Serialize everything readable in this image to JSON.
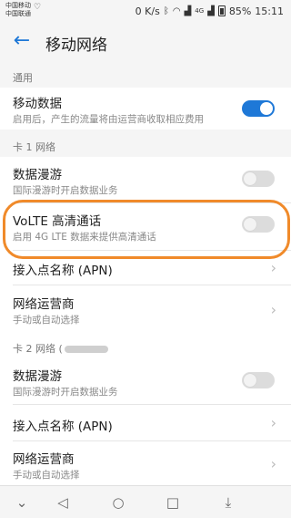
{
  "status_bar": {
    "carrier1": "中国移动",
    "carrier2": "中国联通",
    "speed": "0 K/s",
    "network_tag": "4G",
    "battery": "85%",
    "time": "15:11"
  },
  "header": {
    "title": "移动网络"
  },
  "sections": {
    "general": "通用",
    "sim1": "卡 1 网络",
    "sim2_prefix": "卡 2 网络 ("
  },
  "rows": {
    "mobile_data": {
      "title": "移动数据",
      "subtitle": "启用后，产生的流量将由运营商收取相应费用",
      "on": true
    },
    "roaming1": {
      "title": "数据漫游",
      "subtitle": "国际漫游时开启数据业务",
      "on": false
    },
    "volte": {
      "title": "VoLTE 高清通话",
      "subtitle": "启用 4G LTE 数据来提供高清通话",
      "on": false
    },
    "apn1": {
      "title": "接入点名称 (APN)"
    },
    "operator1": {
      "title": "网络运营商",
      "subtitle": "手动或自动选择"
    },
    "roaming2": {
      "title": "数据漫游",
      "subtitle": "国际漫游时开启数据业务",
      "on": false
    },
    "apn2": {
      "title": "接入点名称 (APN)"
    },
    "operator2": {
      "title": "网络运营商",
      "subtitle": "手动或自动选择"
    }
  },
  "colors": {
    "accent": "#1e78d7",
    "highlight": "#f08a2a"
  }
}
